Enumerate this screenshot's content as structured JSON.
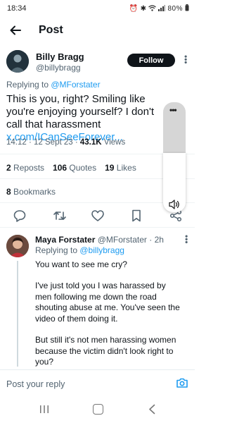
{
  "status_bar": {
    "time": "18:34",
    "battery": "80%"
  },
  "header": {
    "title": "Post"
  },
  "post": {
    "author_name": "Billy Bragg",
    "author_handle": "@billybragg",
    "follow_label": "Follow",
    "replying_prefix": "Replying to ",
    "replying_to": "@MForstater",
    "text": "This is you, right? Smiling like you're enjoying yourself? I don't call that harassment ",
    "link": "x.com/ICanSeeForever...",
    "time": "14:12",
    "date_sep": " · ",
    "date": "12 Sept 23",
    "views_sep": " · ",
    "views_count": "43.1K",
    "views_label": " Views",
    "reposts_count": "2",
    "reposts_label": " Reposts",
    "quotes_count": "106",
    "quotes_label": " Quotes",
    "likes_count": "19",
    "likes_label": " Likes",
    "bookmarks_count": "8",
    "bookmarks_label": " Bookmarks"
  },
  "overlay": {
    "dots": "•••"
  },
  "reply": {
    "author_name": "Maya Forstater",
    "author_handle": " @MForstater",
    "time": " · 2h",
    "replying_prefix": "Replying to ",
    "replying_to": "@billybragg",
    "paragraphs": [
      "You want to see me cry?",
      "I've just told you I was harassed by men following me down the road shouting abuse at me. You've seen the video of them doing it.",
      "But still it's not men harassing women because the victim didn't look right to you?"
    ]
  },
  "composer": {
    "placeholder": "Post your reply"
  },
  "colors": {
    "accent": "#1d9bf0",
    "text": "#0f1419",
    "muted": "#536471"
  }
}
